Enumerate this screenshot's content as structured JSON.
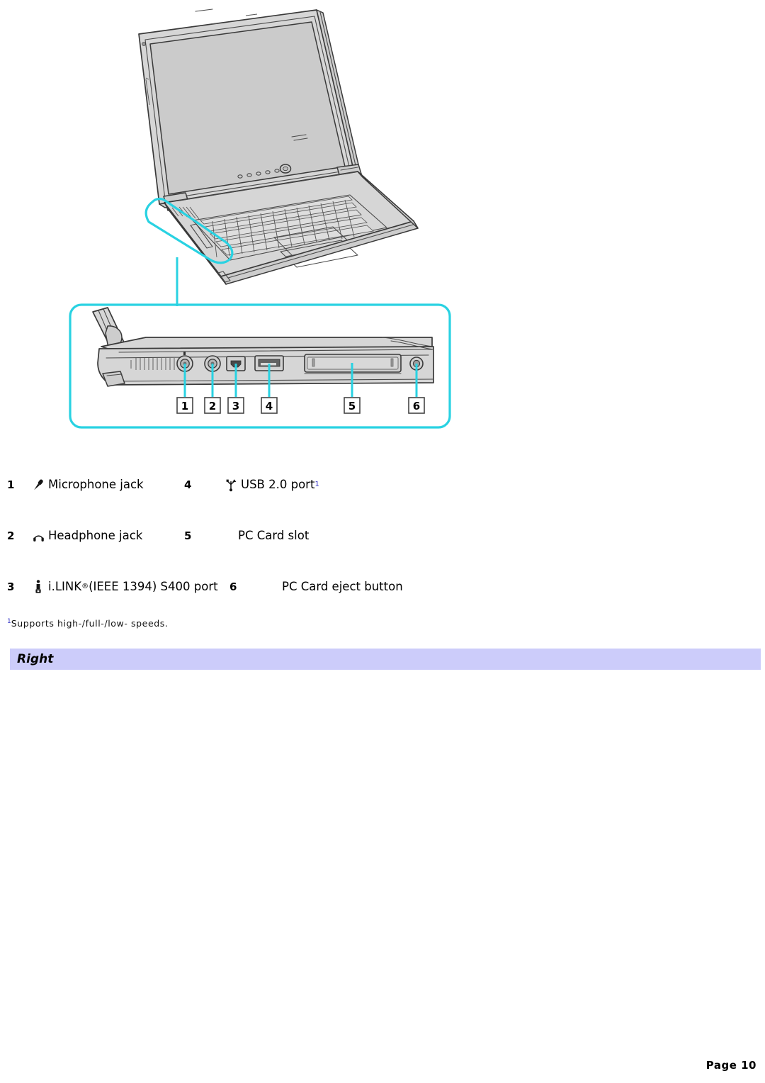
{
  "page": {
    "footer_label": "Page 10"
  },
  "illustration": {
    "alt_name": "laptop-right-side-ports-diagram",
    "callout_color": "#29d2e2",
    "body_fill": "#d6d6d6",
    "outline_color": "#3a3a3a",
    "screen_fill": "#cfcfcf",
    "callouts": [
      {
        "id": "1",
        "label": "1"
      },
      {
        "id": "2",
        "label": "2"
      },
      {
        "id": "3",
        "label": "3"
      },
      {
        "id": "4",
        "label": "4"
      },
      {
        "id": "5",
        "label": "5"
      },
      {
        "id": "6",
        "label": "6"
      }
    ]
  },
  "legend": {
    "rows": [
      {
        "left_num": "1",
        "left_icon": "microphone-icon",
        "left_label": "Microphone jack",
        "right_num": "4",
        "right_icon": "usb-icon",
        "right_label": "USB 2.0 port",
        "right_sup": "1"
      },
      {
        "left_num": "2",
        "left_icon": "headphone-icon",
        "left_label": "Headphone jack",
        "right_num": "5",
        "right_icon": "none",
        "right_label": "PC Card slot",
        "right_sup": ""
      },
      {
        "left_num": "3",
        "left_icon": "ilink-icon",
        "left_label_pre": "i.LINK",
        "left_label_reg": "®",
        "left_label_post": " (IEEE 1394) S400 port",
        "right_num": "6",
        "right_icon": "none",
        "right_label": "PC Card eject button",
        "right_sup": ""
      }
    ]
  },
  "footnote": {
    "marker": "1",
    "text": "Supports high-/full-/low- speeds."
  },
  "section": {
    "title": "Right",
    "bar_color": "#ccccfa"
  }
}
